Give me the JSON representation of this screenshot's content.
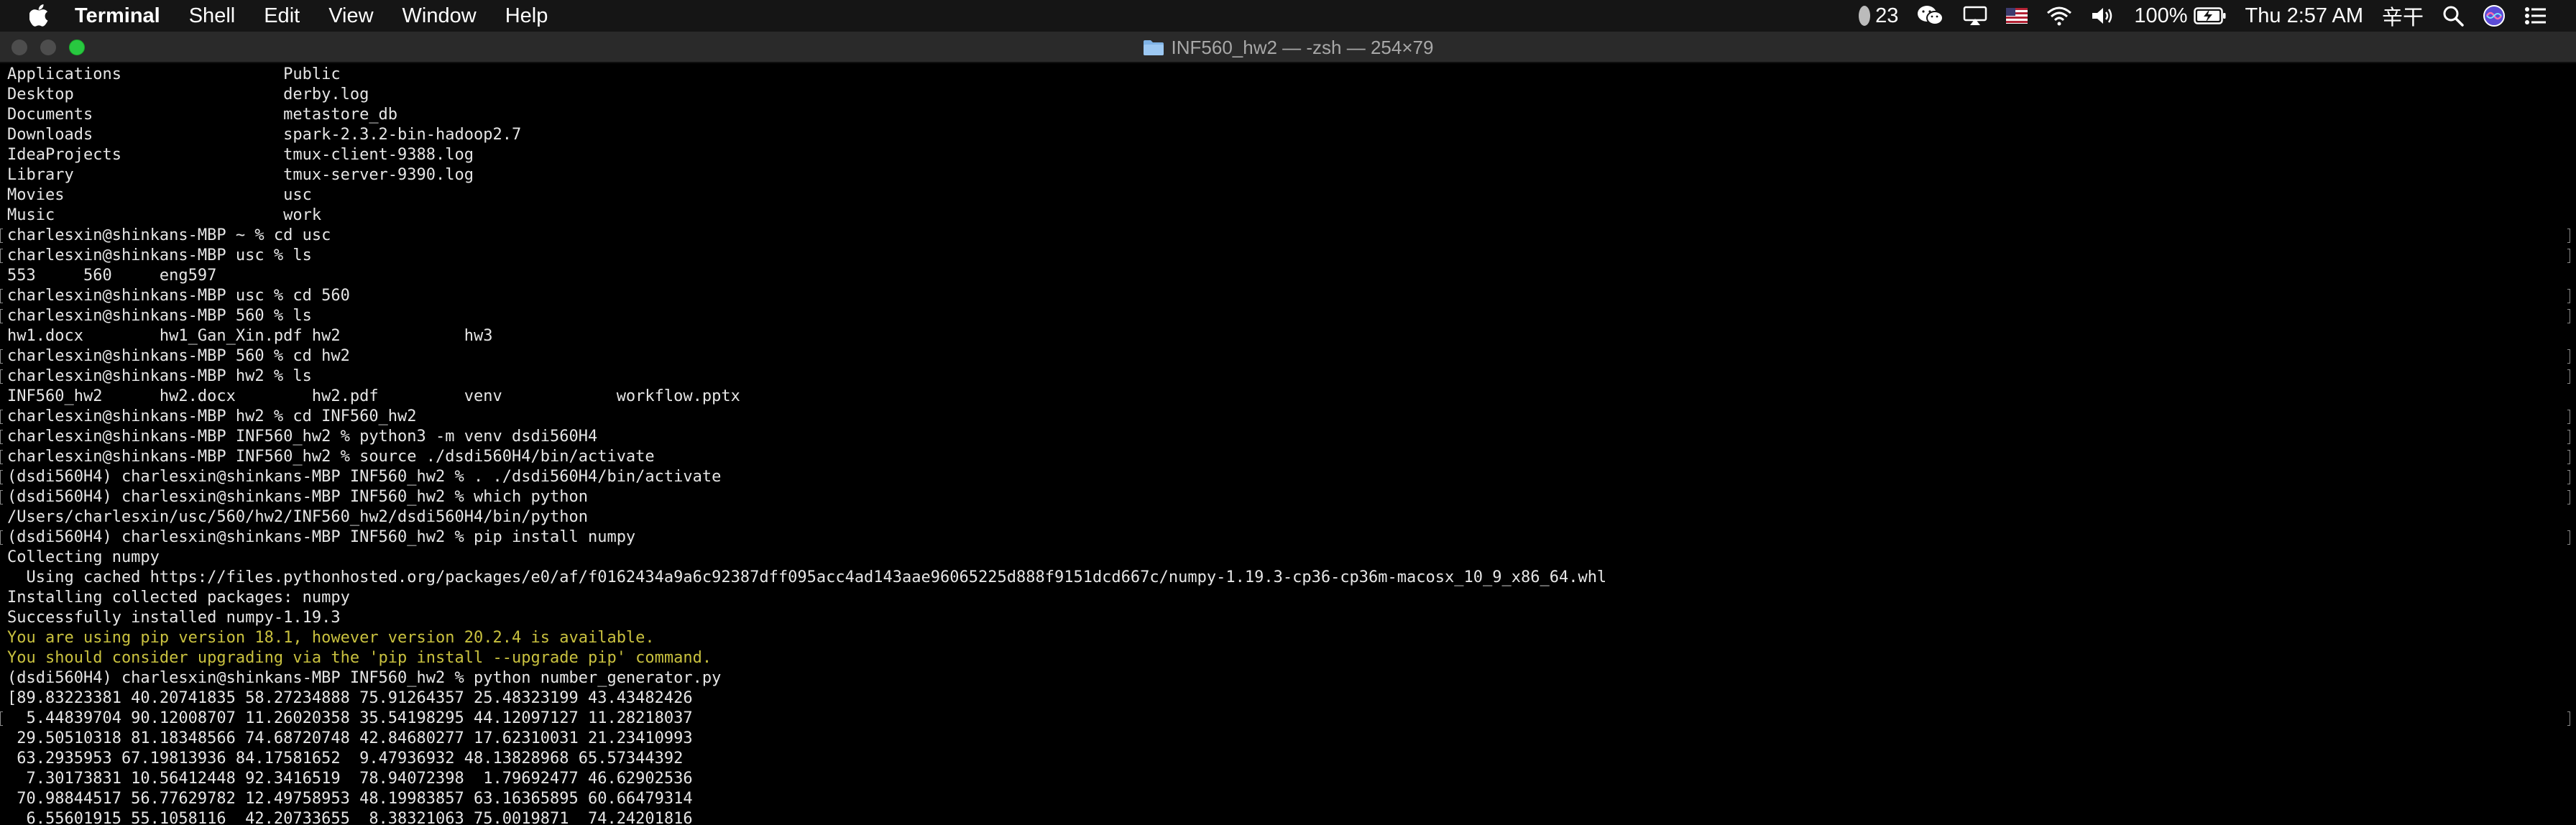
{
  "menubar": {
    "app_name": "Terminal",
    "items": [
      "Shell",
      "Edit",
      "View",
      "Window",
      "Help"
    ],
    "status": {
      "notification_count": "23",
      "battery": "100%",
      "clock": "Thu 2:57 AM",
      "input_method": "辛干"
    }
  },
  "window": {
    "title": "INF560_hw2 — -zsh — 254×79"
  },
  "terminal": {
    "lines": [
      {
        "text": "Applications                 Public",
        "marked": false
      },
      {
        "text": "Desktop                      derby.log",
        "marked": false
      },
      {
        "text": "Documents                    metastore_db",
        "marked": false
      },
      {
        "text": "Downloads                    spark-2.3.2-bin-hadoop2.7",
        "marked": false
      },
      {
        "text": "IdeaProjects                 tmux-client-9388.log",
        "marked": false
      },
      {
        "text": "Library                      tmux-server-9390.log",
        "marked": false
      },
      {
        "text": "Movies                       usc",
        "marked": false
      },
      {
        "text": "Music                        work",
        "marked": false
      },
      {
        "text": "charlesxin@shinkans-MBP ~ % cd usc",
        "marked": true
      },
      {
        "text": "charlesxin@shinkans-MBP usc % ls",
        "marked": true
      },
      {
        "text": "553     560     eng597",
        "marked": false
      },
      {
        "text": "charlesxin@shinkans-MBP usc % cd 560",
        "marked": true
      },
      {
        "text": "charlesxin@shinkans-MBP 560 % ls",
        "marked": true
      },
      {
        "text": "hw1.docx        hw1_Gan_Xin.pdf hw2             hw3",
        "marked": false
      },
      {
        "text": "charlesxin@shinkans-MBP 560 % cd hw2",
        "marked": true
      },
      {
        "text": "charlesxin@shinkans-MBP hw2 % ls",
        "marked": true
      },
      {
        "text": "INF560_hw2      hw2.docx        hw2.pdf         venv            workflow.pptx",
        "marked": false
      },
      {
        "text": "charlesxin@shinkans-MBP hw2 % cd INF560_hw2",
        "marked": true
      },
      {
        "text": "charlesxin@shinkans-MBP INF560_hw2 % python3 -m venv dsdi560H4",
        "marked": true
      },
      {
        "text": "charlesxin@shinkans-MBP INF560_hw2 % source ./dsdi560H4/bin/activate",
        "marked": true
      },
      {
        "text": "(dsdi560H4) charlesxin@shinkans-MBP INF560_hw2 % . ./dsdi560H4/bin/activate",
        "marked": true
      },
      {
        "text": "(dsdi560H4) charlesxin@shinkans-MBP INF560_hw2 % which python",
        "marked": true
      },
      {
        "text": "/Users/charlesxin/usc/560/hw2/INF560_hw2/dsdi560H4/bin/python",
        "marked": false
      },
      {
        "text": "(dsdi560H4) charlesxin@shinkans-MBP INF560_hw2 % pip install numpy",
        "marked": true
      },
      {
        "text": "Collecting numpy",
        "marked": false
      },
      {
        "text": "  Using cached https://files.pythonhosted.org/packages/e0/af/f0162434a9a6c92387dff095acc4ad143aae96065225d888f9151dcd667c/numpy-1.19.3-cp36-cp36m-macosx_10_9_x86_64.whl",
        "marked": false
      },
      {
        "text": "Installing collected packages: numpy",
        "marked": false
      },
      {
        "text": "Successfully installed numpy-1.19.3",
        "marked": false
      },
      {
        "text": "You are using pip version 18.1, however version 20.2.4 is available.",
        "marked": false,
        "warn": true
      },
      {
        "text": "You should consider upgrading via the 'pip install --upgrade pip' command.",
        "marked": false,
        "warn": true
      },
      {
        "text": "(dsdi560H4) charlesxin@shinkans-MBP INF560_hw2 % python number_generator.py",
        "marked": false
      },
      {
        "text": "[89.83223381 40.20741835 58.27234888 75.91264357 25.48323199 43.43482426",
        "marked": false
      },
      {
        "text": "  5.44839704 90.12008707 11.26020358 35.54198295 44.12097127 11.28218037",
        "marked": true
      },
      {
        "text": " 29.50510318 81.18348566 74.68720748 42.84680277 17.62310031 21.23410993",
        "marked": false
      },
      {
        "text": " 63.2935953 67.19813936 84.17581652  9.47936932 48.13828968 65.57344392",
        "marked": false
      },
      {
        "text": "  7.30173831 10.56412448 92.3416519  78.94072398  1.79692477 46.62902536",
        "marked": false
      },
      {
        "text": " 70.98844517 56.77629782 12.49758953 48.19983857 63.16365895 60.66479314",
        "marked": false
      },
      {
        "text": "  6.55601915 55.1058116  42.20733655  8.38321063 75.0019871  74.24201816",
        "marked": false
      }
    ]
  },
  "colors": {
    "menubar_bg": "#151515",
    "titlebar_bg": "#2a2a2a",
    "terminal_bg": "#000000",
    "terminal_fg": "#e6e6e6",
    "warning_fg": "#c9c13f",
    "zoom_button": "#28c840"
  },
  "icons": {
    "menubar_left": "apple-icon",
    "menubar_right": [
      "notification-icon",
      "wechat-icon",
      "airplay-icon",
      "flag-icon",
      "wifi-icon",
      "volume-icon",
      "battery-icon",
      "search-icon",
      "siri-icon",
      "control-center-icon"
    ],
    "title": "folder-icon"
  }
}
